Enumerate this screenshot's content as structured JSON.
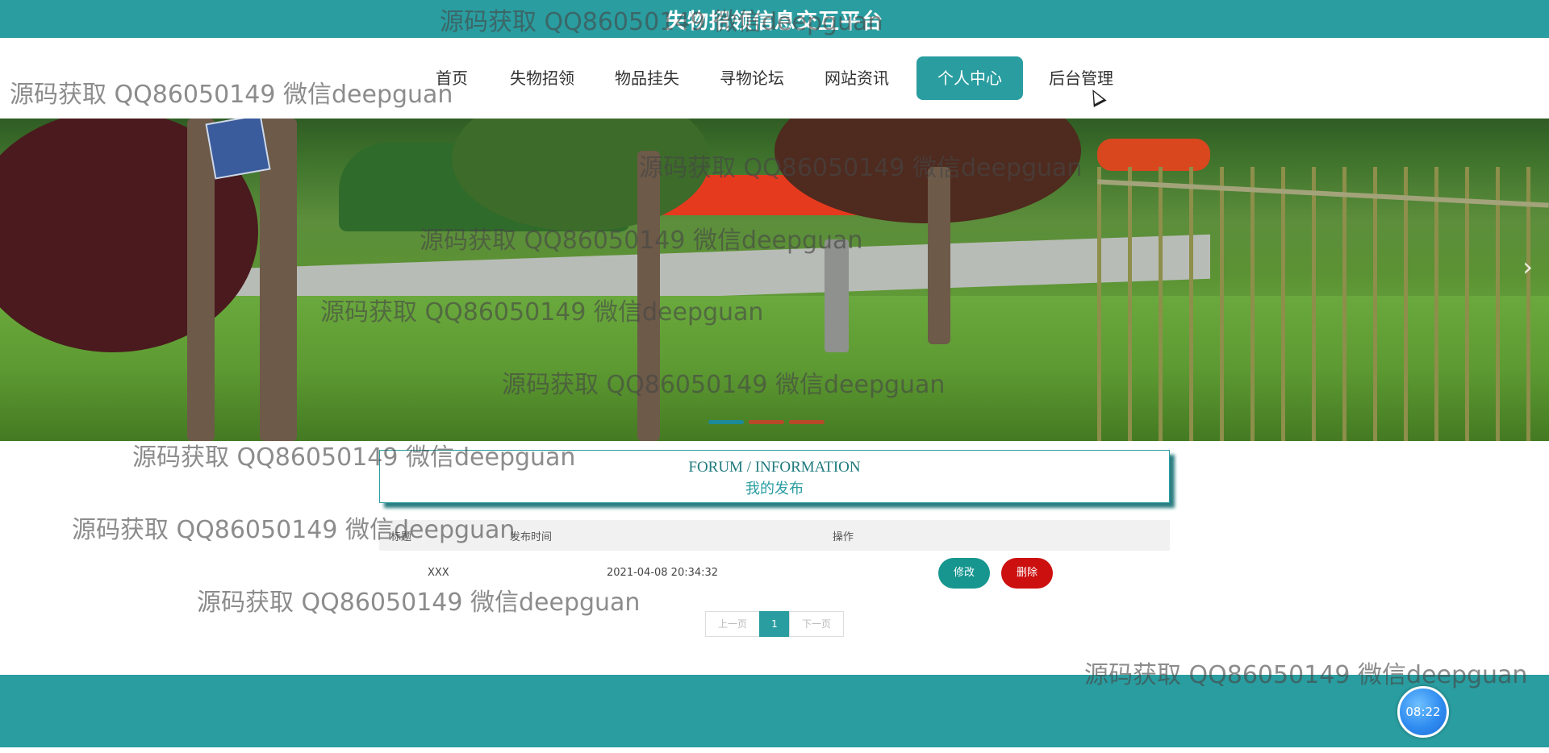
{
  "site": {
    "title": "失物招领信息交互平台"
  },
  "nav": {
    "items": [
      {
        "label": "首页"
      },
      {
        "label": "失物招领"
      },
      {
        "label": "物品挂失"
      },
      {
        "label": "寻物论坛"
      },
      {
        "label": "网站资讯"
      },
      {
        "label": "个人中心",
        "active": true
      },
      {
        "label": "后台管理"
      }
    ]
  },
  "banner": {
    "next_icon": "chevron-right-icon",
    "dots": 3,
    "active_dot": 1,
    "dot_colors": [
      "#1c8a9a",
      "#b84a2a",
      "#b84a2a"
    ]
  },
  "section": {
    "title_en": "FORUM / INFORMATION",
    "title_cn": "我的发布"
  },
  "table": {
    "headers": [
      "标题",
      "发布时间",
      "操作"
    ],
    "rows": [
      {
        "title": "XXX",
        "time": "2021-04-08 20:34:32",
        "edit_label": "修改",
        "delete_label": "删除"
      }
    ]
  },
  "pager": {
    "prev": "上一页",
    "current": "1",
    "next": "下一页"
  },
  "clock": {
    "time": "08:22"
  },
  "watermark": "源码获取 QQ86050149 微信deepguan",
  "colors": {
    "primary": "#2a9da0",
    "danger": "#cc1010",
    "text": "#333333"
  }
}
